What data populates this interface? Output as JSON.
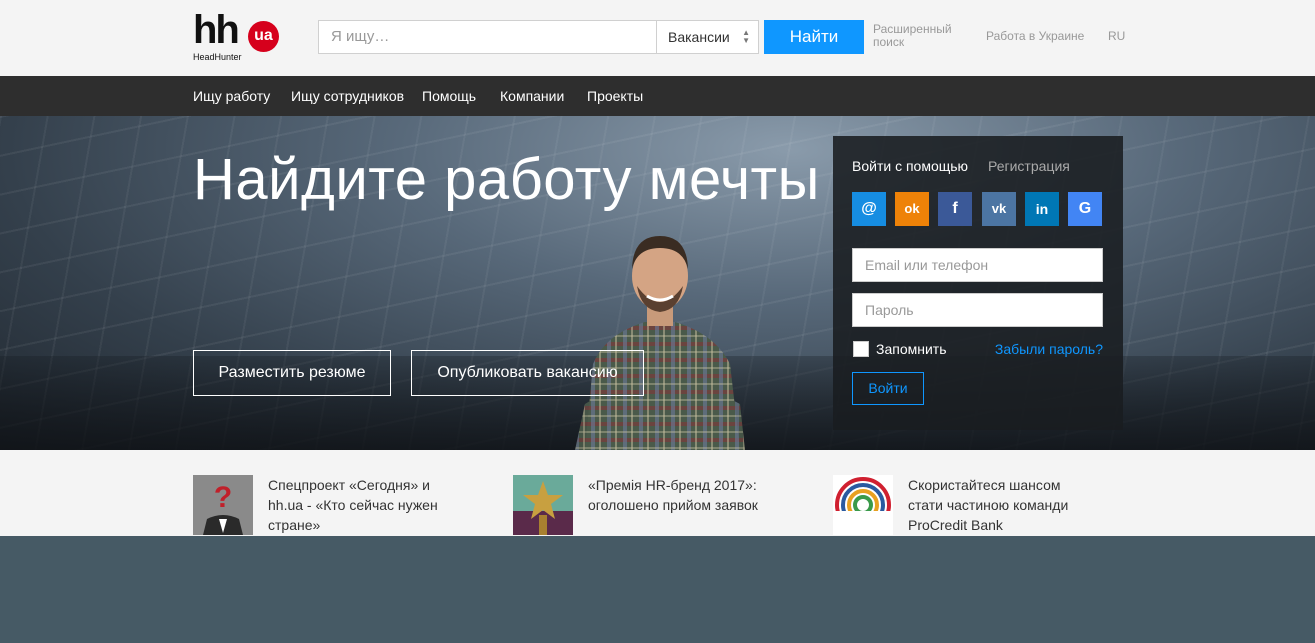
{
  "header": {
    "logo_text": "hh",
    "logo_badge": "ua",
    "logo_sub": "HeadHunter",
    "search_placeholder": "Я ищу…",
    "search_type": "Вакансии",
    "search_button": "Найти",
    "advanced_search": "Расширенный поиск",
    "region_link": "Работа в Украине",
    "language": "RU"
  },
  "nav": {
    "items": [
      {
        "label": "Ищу работу"
      },
      {
        "label": "Ищу сотрудников"
      },
      {
        "label": "Помощь"
      },
      {
        "label": "Компании"
      },
      {
        "label": "Проекты"
      }
    ]
  },
  "hero": {
    "title": "Найдите работу мечты",
    "post_resume": "Разместить резюме",
    "post_vacancy": "Опубликовать вакансию"
  },
  "login": {
    "tab_login": "Войти с помощью",
    "tab_register": "Регистрация",
    "social": [
      {
        "name": "mail-icon",
        "glyph": "@",
        "color": "#168de2"
      },
      {
        "name": "odnoklassniki-icon",
        "glyph": "ok",
        "color": "#ee8208"
      },
      {
        "name": "facebook-icon",
        "glyph": "f",
        "color": "#3b5998"
      },
      {
        "name": "vk-icon",
        "glyph": "vk",
        "color": "#4c75a3"
      },
      {
        "name": "linkedin-icon",
        "glyph": "in",
        "color": "#0077b5"
      },
      {
        "name": "google-icon",
        "glyph": "G",
        "color": "#4285f4"
      }
    ],
    "email_placeholder": "Email или телефон",
    "password_placeholder": "Пароль",
    "remember": "Запомнить",
    "forgot": "Забыли пароль?",
    "submit": "Войти"
  },
  "news": [
    {
      "text": "Спецпроект «Сегодня» и hh.ua - «Кто сейчас нужен стране»"
    },
    {
      "text": "«Премія HR-бренд 2017»: оголошено прийом заявок"
    },
    {
      "text": "Скористайтеся шансом стати частиною команди ProCredit Bank"
    }
  ]
}
